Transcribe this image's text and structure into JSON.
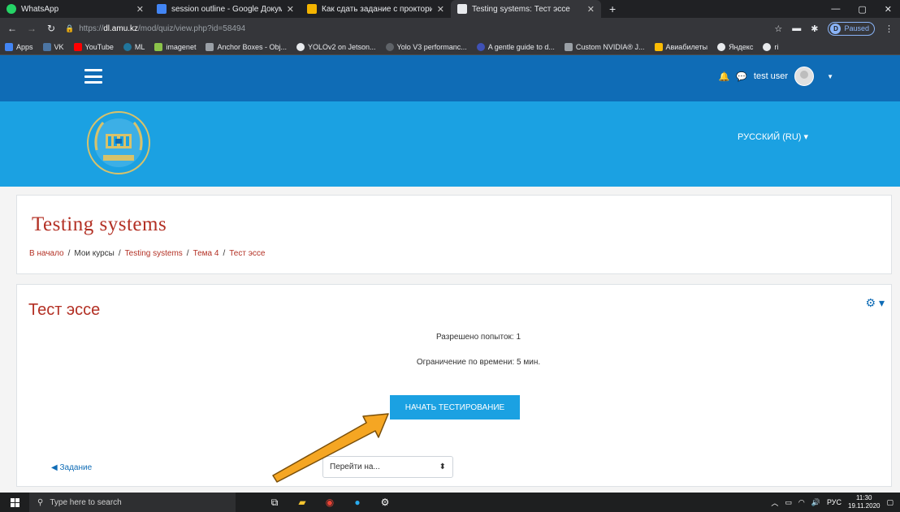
{
  "browser": {
    "tabs": [
      {
        "title": "WhatsApp",
        "icon": "whatsapp-icon",
        "active": false
      },
      {
        "title": "session outline - Google Докуме",
        "icon": "docs-icon",
        "active": false
      },
      {
        "title": "Как сдать задание с прокторин",
        "icon": "slides-icon",
        "active": false
      },
      {
        "title": "Testing systems: Тест эссе",
        "icon": "moodle-icon",
        "active": true
      }
    ],
    "new_tab": "+",
    "url_scheme": "https://",
    "url_host": "dl.amu.kz",
    "url_path": "/mod/quiz/view.php?id=58494",
    "profile_letter": "D",
    "profile_status": "Paused",
    "bookmarks": [
      "Apps",
      "VK",
      "YouTube",
      "ML",
      "imagenet",
      "Anchor Boxes - Obj...",
      "YOLOv2 on Jetson...",
      "Yolo V3 performanc...",
      "A gentle guide to d...",
      "Custom NVIDIA® J...",
      "Авиабилеты",
      "Яндекс",
      "ri"
    ]
  },
  "header": {
    "user_name": "test user",
    "language": "РУССКИЙ (RU)"
  },
  "course": {
    "title": "Testing systems",
    "breadcrumb": [
      {
        "label": "В начало",
        "link": true
      },
      {
        "label": "Мои курсы",
        "link": false
      },
      {
        "label": "Testing systems",
        "link": true
      },
      {
        "label": "Тема 4",
        "link": true
      },
      {
        "label": "Тест эссе",
        "link": true
      }
    ],
    "separator": "/"
  },
  "quiz": {
    "title": "Тест эссе",
    "attempts_allowed": "Разрешено попыток: 1",
    "time_limit": "Ограничение по времени: 5 мин.",
    "start_button": "НАЧАТЬ ТЕСТИРОВАНИЕ",
    "prev_activity": "◀ Задание",
    "jump_placeholder": "Перейти на..."
  },
  "colors": {
    "nav_blue": "#0f6cb6",
    "banner_blue": "#1ba1e2",
    "title_red": "#b33024",
    "arrow_orange": "#f5a623"
  },
  "taskbar": {
    "search_placeholder": "Type here to search",
    "language": "РУС",
    "time": "11:30",
    "date": "19.11.2020"
  }
}
